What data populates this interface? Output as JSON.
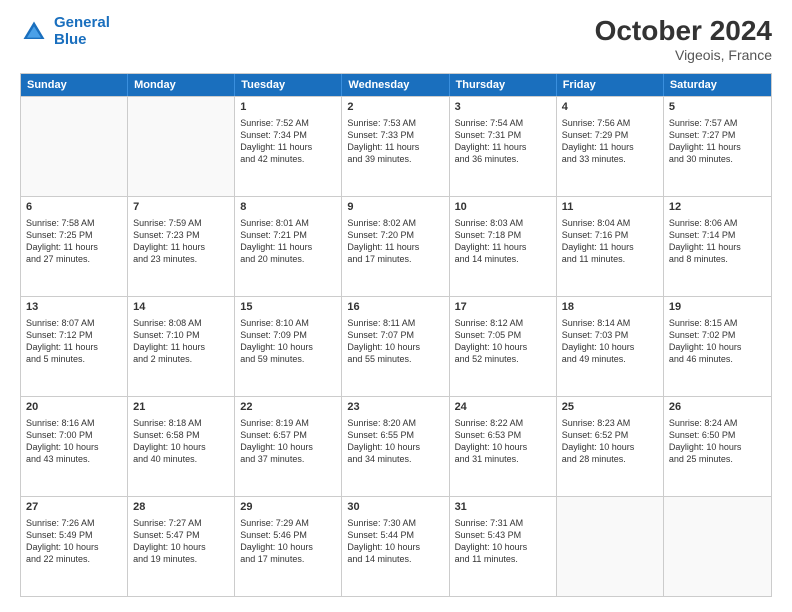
{
  "logo": {
    "line1": "General",
    "line2": "Blue"
  },
  "title": "October 2024",
  "location": "Vigeois, France",
  "days": [
    "Sunday",
    "Monday",
    "Tuesday",
    "Wednesday",
    "Thursday",
    "Friday",
    "Saturday"
  ],
  "weeks": [
    [
      {
        "day": "",
        "lines": []
      },
      {
        "day": "",
        "lines": []
      },
      {
        "day": "1",
        "lines": [
          "Sunrise: 7:52 AM",
          "Sunset: 7:34 PM",
          "Daylight: 11 hours",
          "and 42 minutes."
        ]
      },
      {
        "day": "2",
        "lines": [
          "Sunrise: 7:53 AM",
          "Sunset: 7:33 PM",
          "Daylight: 11 hours",
          "and 39 minutes."
        ]
      },
      {
        "day": "3",
        "lines": [
          "Sunrise: 7:54 AM",
          "Sunset: 7:31 PM",
          "Daylight: 11 hours",
          "and 36 minutes."
        ]
      },
      {
        "day": "4",
        "lines": [
          "Sunrise: 7:56 AM",
          "Sunset: 7:29 PM",
          "Daylight: 11 hours",
          "and 33 minutes."
        ]
      },
      {
        "day": "5",
        "lines": [
          "Sunrise: 7:57 AM",
          "Sunset: 7:27 PM",
          "Daylight: 11 hours",
          "and 30 minutes."
        ]
      }
    ],
    [
      {
        "day": "6",
        "lines": [
          "Sunrise: 7:58 AM",
          "Sunset: 7:25 PM",
          "Daylight: 11 hours",
          "and 27 minutes."
        ]
      },
      {
        "day": "7",
        "lines": [
          "Sunrise: 7:59 AM",
          "Sunset: 7:23 PM",
          "Daylight: 11 hours",
          "and 23 minutes."
        ]
      },
      {
        "day": "8",
        "lines": [
          "Sunrise: 8:01 AM",
          "Sunset: 7:21 PM",
          "Daylight: 11 hours",
          "and 20 minutes."
        ]
      },
      {
        "day": "9",
        "lines": [
          "Sunrise: 8:02 AM",
          "Sunset: 7:20 PM",
          "Daylight: 11 hours",
          "and 17 minutes."
        ]
      },
      {
        "day": "10",
        "lines": [
          "Sunrise: 8:03 AM",
          "Sunset: 7:18 PM",
          "Daylight: 11 hours",
          "and 14 minutes."
        ]
      },
      {
        "day": "11",
        "lines": [
          "Sunrise: 8:04 AM",
          "Sunset: 7:16 PM",
          "Daylight: 11 hours",
          "and 11 minutes."
        ]
      },
      {
        "day": "12",
        "lines": [
          "Sunrise: 8:06 AM",
          "Sunset: 7:14 PM",
          "Daylight: 11 hours",
          "and 8 minutes."
        ]
      }
    ],
    [
      {
        "day": "13",
        "lines": [
          "Sunrise: 8:07 AM",
          "Sunset: 7:12 PM",
          "Daylight: 11 hours",
          "and 5 minutes."
        ]
      },
      {
        "day": "14",
        "lines": [
          "Sunrise: 8:08 AM",
          "Sunset: 7:10 PM",
          "Daylight: 11 hours",
          "and 2 minutes."
        ]
      },
      {
        "day": "15",
        "lines": [
          "Sunrise: 8:10 AM",
          "Sunset: 7:09 PM",
          "Daylight: 10 hours",
          "and 59 minutes."
        ]
      },
      {
        "day": "16",
        "lines": [
          "Sunrise: 8:11 AM",
          "Sunset: 7:07 PM",
          "Daylight: 10 hours",
          "and 55 minutes."
        ]
      },
      {
        "day": "17",
        "lines": [
          "Sunrise: 8:12 AM",
          "Sunset: 7:05 PM",
          "Daylight: 10 hours",
          "and 52 minutes."
        ]
      },
      {
        "day": "18",
        "lines": [
          "Sunrise: 8:14 AM",
          "Sunset: 7:03 PM",
          "Daylight: 10 hours",
          "and 49 minutes."
        ]
      },
      {
        "day": "19",
        "lines": [
          "Sunrise: 8:15 AM",
          "Sunset: 7:02 PM",
          "Daylight: 10 hours",
          "and 46 minutes."
        ]
      }
    ],
    [
      {
        "day": "20",
        "lines": [
          "Sunrise: 8:16 AM",
          "Sunset: 7:00 PM",
          "Daylight: 10 hours",
          "and 43 minutes."
        ]
      },
      {
        "day": "21",
        "lines": [
          "Sunrise: 8:18 AM",
          "Sunset: 6:58 PM",
          "Daylight: 10 hours",
          "and 40 minutes."
        ]
      },
      {
        "day": "22",
        "lines": [
          "Sunrise: 8:19 AM",
          "Sunset: 6:57 PM",
          "Daylight: 10 hours",
          "and 37 minutes."
        ]
      },
      {
        "day": "23",
        "lines": [
          "Sunrise: 8:20 AM",
          "Sunset: 6:55 PM",
          "Daylight: 10 hours",
          "and 34 minutes."
        ]
      },
      {
        "day": "24",
        "lines": [
          "Sunrise: 8:22 AM",
          "Sunset: 6:53 PM",
          "Daylight: 10 hours",
          "and 31 minutes."
        ]
      },
      {
        "day": "25",
        "lines": [
          "Sunrise: 8:23 AM",
          "Sunset: 6:52 PM",
          "Daylight: 10 hours",
          "and 28 minutes."
        ]
      },
      {
        "day": "26",
        "lines": [
          "Sunrise: 8:24 AM",
          "Sunset: 6:50 PM",
          "Daylight: 10 hours",
          "and 25 minutes."
        ]
      }
    ],
    [
      {
        "day": "27",
        "lines": [
          "Sunrise: 7:26 AM",
          "Sunset: 5:49 PM",
          "Daylight: 10 hours",
          "and 22 minutes."
        ]
      },
      {
        "day": "28",
        "lines": [
          "Sunrise: 7:27 AM",
          "Sunset: 5:47 PM",
          "Daylight: 10 hours",
          "and 19 minutes."
        ]
      },
      {
        "day": "29",
        "lines": [
          "Sunrise: 7:29 AM",
          "Sunset: 5:46 PM",
          "Daylight: 10 hours",
          "and 17 minutes."
        ]
      },
      {
        "day": "30",
        "lines": [
          "Sunrise: 7:30 AM",
          "Sunset: 5:44 PM",
          "Daylight: 10 hours",
          "and 14 minutes."
        ]
      },
      {
        "day": "31",
        "lines": [
          "Sunrise: 7:31 AM",
          "Sunset: 5:43 PM",
          "Daylight: 10 hours",
          "and 11 minutes."
        ]
      },
      {
        "day": "",
        "lines": []
      },
      {
        "day": "",
        "lines": []
      }
    ]
  ]
}
